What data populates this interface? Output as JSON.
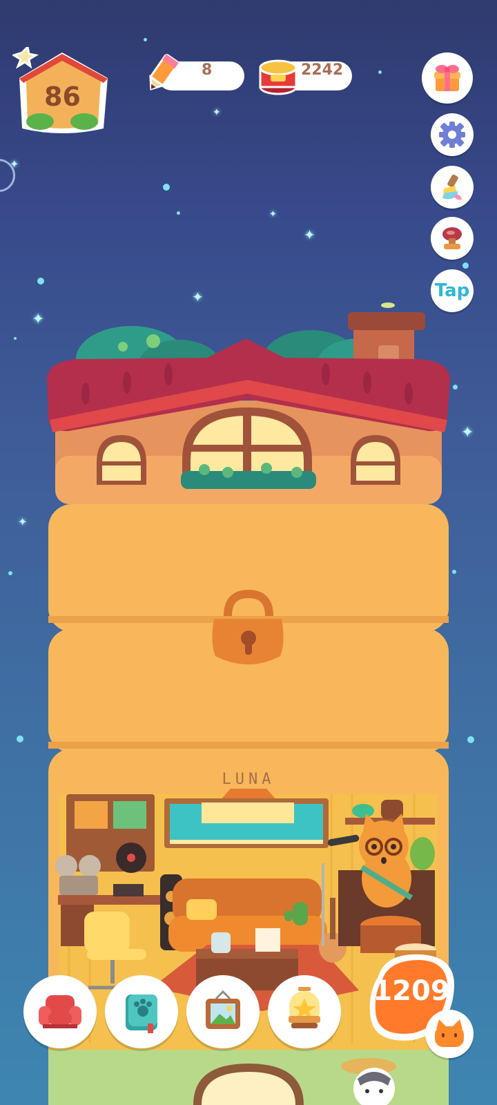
{
  "home": {
    "level": "86"
  },
  "currencies": {
    "pencils": {
      "value": "8",
      "icon": "pencil-icon"
    },
    "cans": {
      "value": "2242",
      "icon": "tuna-can-icon"
    }
  },
  "side_buttons": {
    "gift": "gift-icon",
    "settings": "gear-icon",
    "paint": "paint-brush-icon",
    "stamp": "stamp-icon",
    "tap_label": "Tap"
  },
  "house": {
    "floors": [
      "attic",
      "locked",
      "luna-room"
    ],
    "room_name": "LUNA"
  },
  "bottom_bar": {
    "buttons": [
      "furniture-chair-icon",
      "cat-book-icon",
      "picture-frame-icon",
      "trophy-lamp-icon"
    ],
    "counter": "1209"
  },
  "colors": {
    "roof": "#b23a4b",
    "wall": "#f5b95e",
    "accent_orange": "#ff7a2a",
    "tap_blue": "#2fb6d6"
  }
}
